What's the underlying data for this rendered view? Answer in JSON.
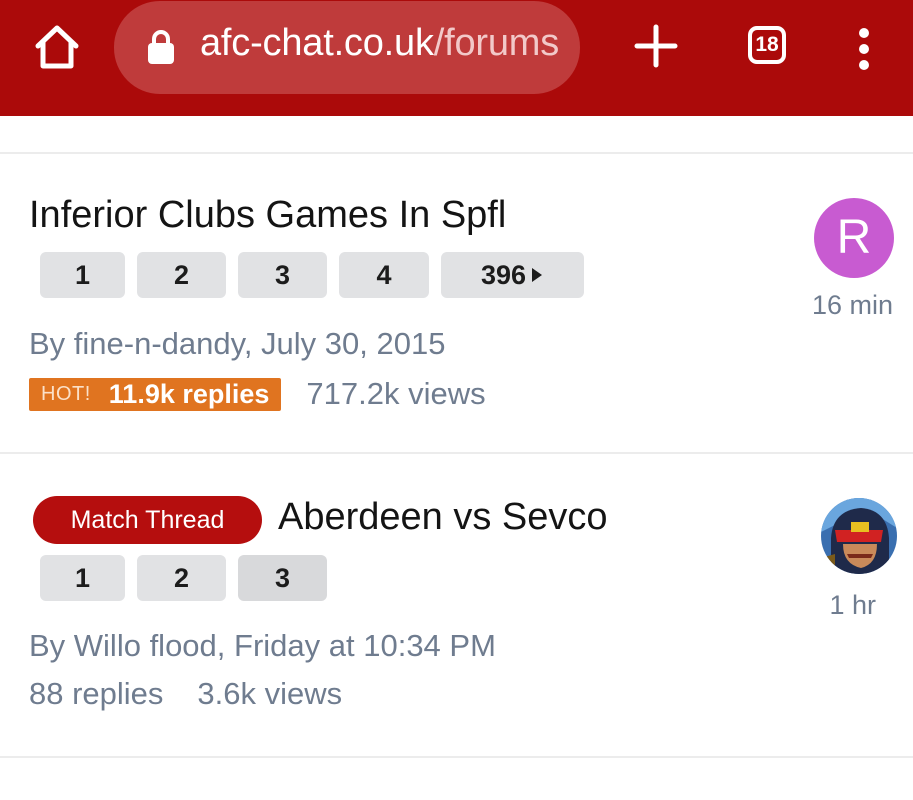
{
  "browser": {
    "url_domain": "afc-chat.co.uk",
    "url_path": "/forums",
    "tab_count": "18",
    "icons": [
      "home-icon",
      "lock-icon",
      "plus-icon",
      "tabs-icon",
      "more-vert-icon"
    ],
    "bar_color": "#ab0a0a"
  },
  "threads": [
    {
      "title": "Inferior Clubs Games In Spfl",
      "pages": [
        "1",
        "2",
        "3",
        "4",
        "396"
      ],
      "byline": "By fine-n-dandy, July 30, 2015",
      "hot_label": "HOT!",
      "replies": "11.9k replies",
      "views": "717.2k views",
      "avatar_letter": "R",
      "avatar_color": "#c85bd1",
      "time": "16 min"
    },
    {
      "prefix": "Match Thread",
      "title": "Aberdeen vs Sevco",
      "pages": [
        "1",
        "2",
        "3"
      ],
      "byline": "By Willo flood, Friday at 10:34 PM",
      "replies": "88 replies",
      "views": "3.6k views",
      "avatar_icon": "judge-dredd-avatar-icon",
      "time": "1 hr"
    }
  ]
}
